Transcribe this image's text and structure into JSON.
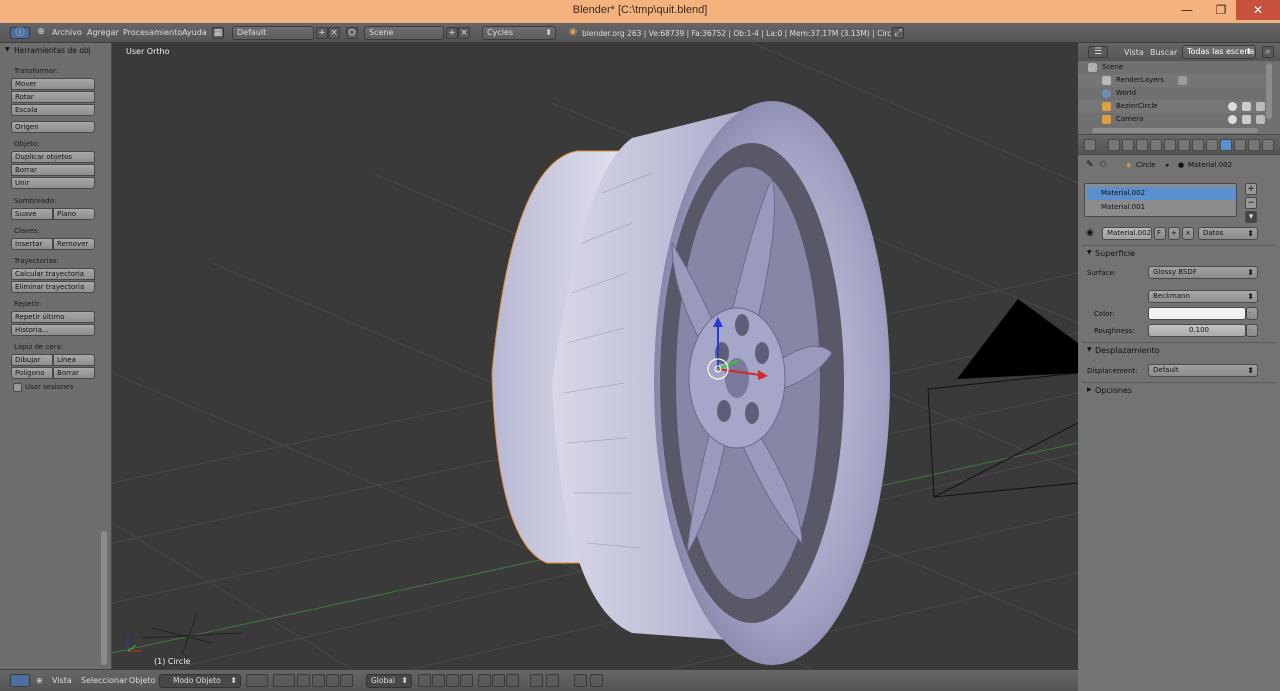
{
  "window": {
    "title": "Blender* [C:\\tmp\\quit.blend]",
    "minimize": "—",
    "maximize": "❐",
    "close": "✕"
  },
  "topbar": {
    "menu": [
      "Archivo",
      "Agregar",
      "Procesamiento",
      "Ayuda"
    ],
    "layout": "Default",
    "scene": "Scene",
    "engine": "Cycles",
    "stats": "blender.org 263 | Ve:68739 | Fa:36752 | Ob:1-4 | La:0 | Mem:37.17M (3.13M) | Circle"
  },
  "toolshelf": {
    "header": "Herramientas de obj",
    "transform_label": "Transformar:",
    "move": "Mover",
    "rotate": "Rotar",
    "scale": "Escala",
    "origin": "Origen",
    "object_label": "Objeto:",
    "duplicate": "Duplicar objetos",
    "delete": "Borrar",
    "join": "Unir",
    "shading_label": "Sombreado:",
    "smooth": "Suave",
    "flat": "Plano",
    "keys_label": "Claves:",
    "insert": "Insertar",
    "remove": "Remover",
    "paths_label": "Trayectorias:",
    "calc_paths": "Calcular trayectoria",
    "clear_paths": "Eliminar trayectoria",
    "repeat_label": "Repetir:",
    "repeat_last": "Repetir último",
    "history": "Historia...",
    "grease_label": "Lápiz de cera:",
    "draw": "Dibujar",
    "line": "Línea",
    "poly": "Polígono",
    "erase": "Borrar",
    "use_sessions": "Usar sesiones"
  },
  "viewport": {
    "view_label": "User Ortho",
    "object_label": "(1) Circle"
  },
  "bottombar": {
    "menu": [
      "Vista",
      "Seleccionar",
      "Objeto"
    ],
    "mode": "Modo Objeto",
    "orientation": "Global"
  },
  "outliner": {
    "view": "Vista",
    "search": "Buscar",
    "filter": "Todas las escena",
    "items": [
      "Scene",
      "RenderLayers",
      "World",
      "BezierCircle",
      "Camera"
    ]
  },
  "properties": {
    "breadcrumb_object": "Circle",
    "breadcrumb_material": "Material.002",
    "materials": [
      "Material.002",
      "Material.001"
    ],
    "material_name": "Material.002",
    "fake_user": "F",
    "link": "Datos",
    "surface_section": "Superficie",
    "surface_label": "Surface:",
    "surface_value": "Glossy BSDF",
    "distribution": "Beckmann",
    "color_label": "Color:",
    "roughness_label": "Roughness:",
    "roughness_value": "0.100",
    "displacement_section": "Desplazamiento",
    "displacement_label": "Displacement:",
    "displacement_value": "Default",
    "options_section": "Opciones"
  },
  "colors": {
    "accent": "#5a8fd0",
    "titlebar": "#f4b27f",
    "viewport_bg": "#3a3a3a",
    "panel": "#737373"
  }
}
